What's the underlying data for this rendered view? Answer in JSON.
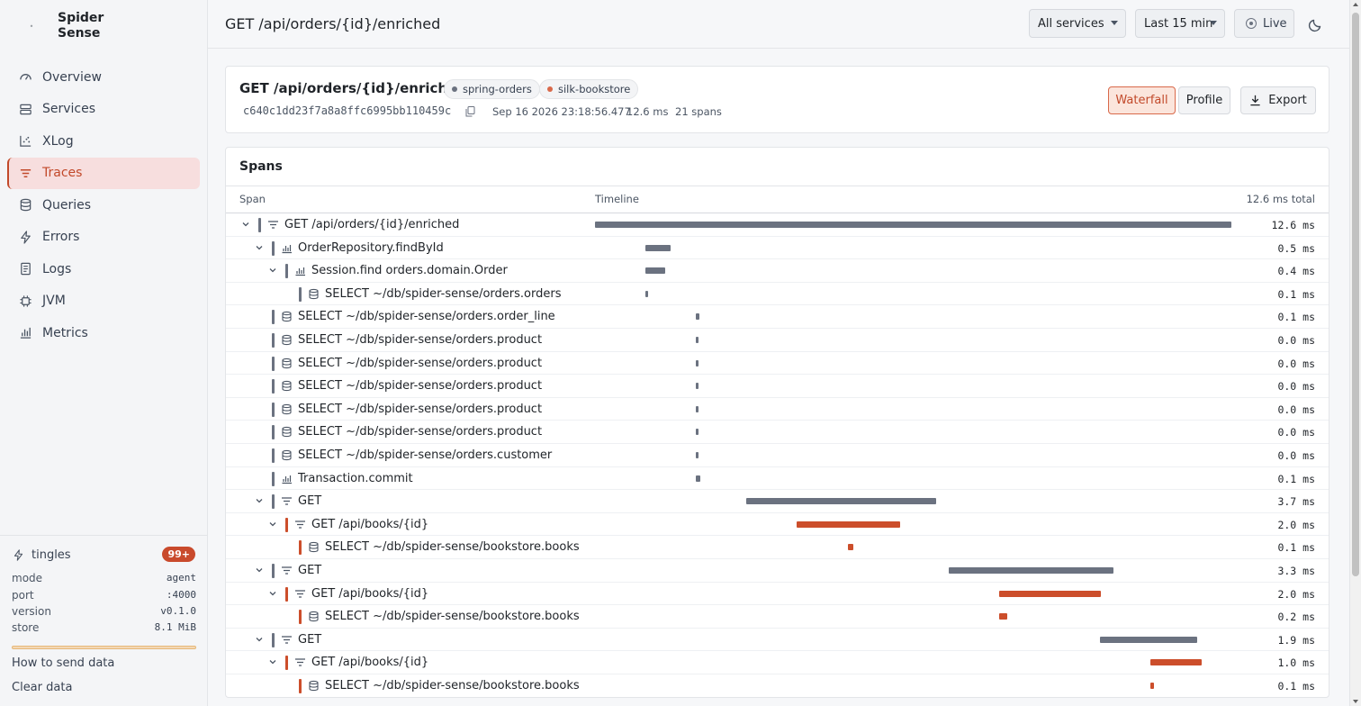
{
  "brand": {
    "name": "Spider Sense"
  },
  "nav": [
    {
      "label": "Overview",
      "icon": "gauge-icon",
      "active": false
    },
    {
      "label": "Services",
      "icon": "server-icon",
      "active": false
    },
    {
      "label": "XLog",
      "icon": "scatter-icon",
      "active": false
    },
    {
      "label": "Traces",
      "icon": "traces-icon",
      "active": true
    },
    {
      "label": "Queries",
      "icon": "database-icon",
      "active": false
    },
    {
      "label": "Errors",
      "icon": "bolt-icon",
      "active": false
    },
    {
      "label": "Logs",
      "icon": "log-icon",
      "active": false
    },
    {
      "label": "JVM",
      "icon": "chip-icon",
      "active": false
    },
    {
      "label": "Metrics",
      "icon": "bar-chart-icon",
      "active": false
    }
  ],
  "footer": {
    "agent_name": "tingles",
    "badge": "99+",
    "info": [
      {
        "k": "mode",
        "v": "agent"
      },
      {
        "k": "port",
        "v": ":4000"
      },
      {
        "k": "version",
        "v": "v0.1.0"
      },
      {
        "k": "store",
        "v": "8.1 MiB"
      }
    ],
    "store_fill": 1.0,
    "how_to": "How to send data",
    "clear": "Clear data"
  },
  "topbar": {
    "title": "GET /api/orders/{id}/enriched",
    "service_select": "All services",
    "range_select": "Last 15 min",
    "live": "Live"
  },
  "trace": {
    "title": "GET /api/orders/{id}/enriched",
    "services": [
      {
        "name": "spring-orders",
        "color": "#6b7280"
      },
      {
        "name": "silk-bookstore",
        "color": "#d9694a"
      }
    ],
    "id": "c640c1dd23f7a8a8ffc6995bb110459c",
    "timestamp": "Sep 16 2026 23:18:56.477",
    "duration": "12.6 ms",
    "span_count": "21 spans",
    "buttons": {
      "waterfall": "Waterfall",
      "profile": "Profile",
      "export": "Export"
    }
  },
  "spans": {
    "heading": "Spans",
    "col_span": "Span",
    "col_timeline": "Timeline",
    "col_total": "12.6 ms total",
    "total_ms": 12.6,
    "colors": {
      "gray": "#6b7280",
      "orange": "#cc4e2b"
    },
    "rows": [
      {
        "depth": 0,
        "expand": true,
        "kind": "http",
        "name": "GET /api/orders/{id}/enriched",
        "start_ms": 0.0,
        "dur_ms": 12.6,
        "dur": "12.6 ms",
        "svc": "gray"
      },
      {
        "depth": 1,
        "expand": true,
        "kind": "repo",
        "name": "OrderRepository.findById",
        "start_ms": 1.0,
        "dur_ms": 0.5,
        "dur": "0.5 ms",
        "svc": "gray"
      },
      {
        "depth": 2,
        "expand": true,
        "kind": "repo",
        "name": "Session.find orders.domain.Order",
        "start_ms": 1.0,
        "dur_ms": 0.4,
        "dur": "0.4 ms",
        "svc": "gray"
      },
      {
        "depth": 3,
        "expand": false,
        "kind": "db",
        "name": "SELECT ~/db/spider-sense/orders.orders",
        "start_ms": 1.0,
        "dur_ms": 0.05,
        "dur": "0.1 ms",
        "svc": "gray"
      },
      {
        "depth": 1,
        "expand": false,
        "kind": "db",
        "name": "SELECT ~/db/spider-sense/orders.order_line",
        "start_ms": 2.0,
        "dur_ms": 0.07,
        "dur": "0.1 ms",
        "svc": "gray"
      },
      {
        "depth": 1,
        "expand": false,
        "kind": "db",
        "name": "SELECT ~/db/spider-sense/orders.product",
        "start_ms": 2.0,
        "dur_ms": 0.05,
        "dur": "0.0 ms",
        "svc": "gray"
      },
      {
        "depth": 1,
        "expand": false,
        "kind": "db",
        "name": "SELECT ~/db/spider-sense/orders.product",
        "start_ms": 2.0,
        "dur_ms": 0.05,
        "dur": "0.0 ms",
        "svc": "gray"
      },
      {
        "depth": 1,
        "expand": false,
        "kind": "db",
        "name": "SELECT ~/db/spider-sense/orders.product",
        "start_ms": 2.0,
        "dur_ms": 0.05,
        "dur": "0.0 ms",
        "svc": "gray"
      },
      {
        "depth": 1,
        "expand": false,
        "kind": "db",
        "name": "SELECT ~/db/spider-sense/orders.product",
        "start_ms": 2.0,
        "dur_ms": 0.05,
        "dur": "0.0 ms",
        "svc": "gray"
      },
      {
        "depth": 1,
        "expand": false,
        "kind": "db",
        "name": "SELECT ~/db/spider-sense/orders.product",
        "start_ms": 2.0,
        "dur_ms": 0.05,
        "dur": "0.0 ms",
        "svc": "gray"
      },
      {
        "depth": 1,
        "expand": false,
        "kind": "db",
        "name": "SELECT ~/db/spider-sense/orders.customer",
        "start_ms": 2.0,
        "dur_ms": 0.05,
        "dur": "0.0 ms",
        "svc": "gray"
      },
      {
        "depth": 1,
        "expand": false,
        "kind": "repo",
        "name": "Transaction.commit",
        "start_ms": 2.0,
        "dur_ms": 0.08,
        "dur": "0.1 ms",
        "svc": "gray"
      },
      {
        "depth": 1,
        "expand": true,
        "kind": "http",
        "name": "GET",
        "start_ms": 3.0,
        "dur_ms": 3.75,
        "dur": "3.7 ms",
        "svc": "gray"
      },
      {
        "depth": 2,
        "expand": true,
        "kind": "http",
        "name": "GET /api/books/{id}",
        "start_ms": 4.0,
        "dur_ms": 2.04,
        "dur": "2.0 ms",
        "svc": "orange"
      },
      {
        "depth": 3,
        "expand": false,
        "kind": "db",
        "name": "SELECT ~/db/spider-sense/bookstore.books",
        "start_ms": 5.0,
        "dur_ms": 0.12,
        "dur": "0.1 ms",
        "svc": "orange"
      },
      {
        "depth": 1,
        "expand": true,
        "kind": "http",
        "name": "GET",
        "start_ms": 7.0,
        "dur_ms": 3.27,
        "dur": "3.3 ms",
        "svc": "gray"
      },
      {
        "depth": 2,
        "expand": true,
        "kind": "http",
        "name": "GET /api/books/{id}",
        "start_ms": 8.0,
        "dur_ms": 2.02,
        "dur": "2.0 ms",
        "svc": "orange"
      },
      {
        "depth": 3,
        "expand": false,
        "kind": "db",
        "name": "SELECT ~/db/spider-sense/bookstore.books",
        "start_ms": 8.0,
        "dur_ms": 0.16,
        "dur": "0.2 ms",
        "svc": "orange"
      },
      {
        "depth": 1,
        "expand": true,
        "kind": "http",
        "name": "GET",
        "start_ms": 10.0,
        "dur_ms": 1.92,
        "dur": "1.9 ms",
        "svc": "gray"
      },
      {
        "depth": 2,
        "expand": true,
        "kind": "http",
        "name": "GET /api/books/{id}",
        "start_ms": 11.0,
        "dur_ms": 1.02,
        "dur": "1.0 ms",
        "svc": "orange"
      },
      {
        "depth": 3,
        "expand": false,
        "kind": "db",
        "name": "SELECT ~/db/spider-sense/bookstore.books",
        "start_ms": 11.0,
        "dur_ms": 0.07,
        "dur": "0.1 ms",
        "svc": "orange"
      }
    ]
  }
}
